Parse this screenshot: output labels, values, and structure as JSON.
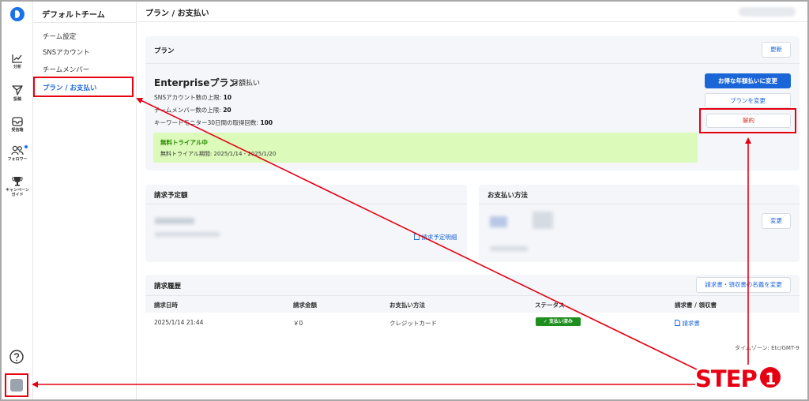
{
  "sidebar": {
    "team_name": "デフォルトチーム",
    "items": [
      {
        "label": "チーム設定"
      },
      {
        "label": "SNSアカウント"
      },
      {
        "label": "チームメンバー"
      },
      {
        "label": "プラン / お支払い",
        "active": true
      }
    ]
  },
  "rail": {
    "items": [
      {
        "label": "分析",
        "icon": "chart-line-icon"
      },
      {
        "label": "投稿",
        "icon": "send-icon"
      },
      {
        "label": "受信箱",
        "icon": "inbox-icon"
      },
      {
        "label": "フォロワー",
        "icon": "users-icon",
        "badge": true
      },
      {
        "label": "キャンペーン",
        "label2": "ガイド",
        "icon": "trophy-icon"
      }
    ]
  },
  "header": {
    "title": "プラン / お支払い"
  },
  "plan": {
    "title": "プラン",
    "update_label": "更新",
    "name": "Enterpriseプラン",
    "cycle": "月額払い",
    "limits": [
      {
        "label": "SNSアカウント数の上限:",
        "value": "10"
      },
      {
        "label": "チームメンバー数の上限:",
        "value": "20"
      },
      {
        "label": "キーワードモニター30日間の取得回数:",
        "value": "100"
      }
    ],
    "trial_title": "無料トライアル中",
    "trial_period": "無料トライアル期間: 2025/1/14 - 2025/1/20",
    "annual_label": "お得な年額払いに変更",
    "change_plan_label": "プランを変更",
    "cancel_label": "解約"
  },
  "billing": {
    "title": "請求予定額",
    "detail_link": "請求予定明細"
  },
  "payment": {
    "title": "お支払い方法",
    "change_label": "変更"
  },
  "history": {
    "title": "請求履歴",
    "change_name_label": "請求書・領収書の名義を変更",
    "columns": [
      "請求日時",
      "請求金額",
      "お支払い方法",
      "ステータス",
      "請求書 / 領収書"
    ],
    "rows": [
      {
        "date": "2025/1/14 21:44",
        "amount": "￥0",
        "method": "クレジットカード",
        "status": "支払い済み",
        "invoice": "請求書"
      }
    ]
  },
  "timezone": "タイムゾーン: Etc/GMT-9",
  "annotation": {
    "step_text": "STEP",
    "step_number": "1",
    "color": "#e60012"
  },
  "colors": {
    "accent": "#1a66d9",
    "success": "#1e8e1e",
    "trial_bg": "#dcfaba",
    "danger": "#d93025"
  }
}
